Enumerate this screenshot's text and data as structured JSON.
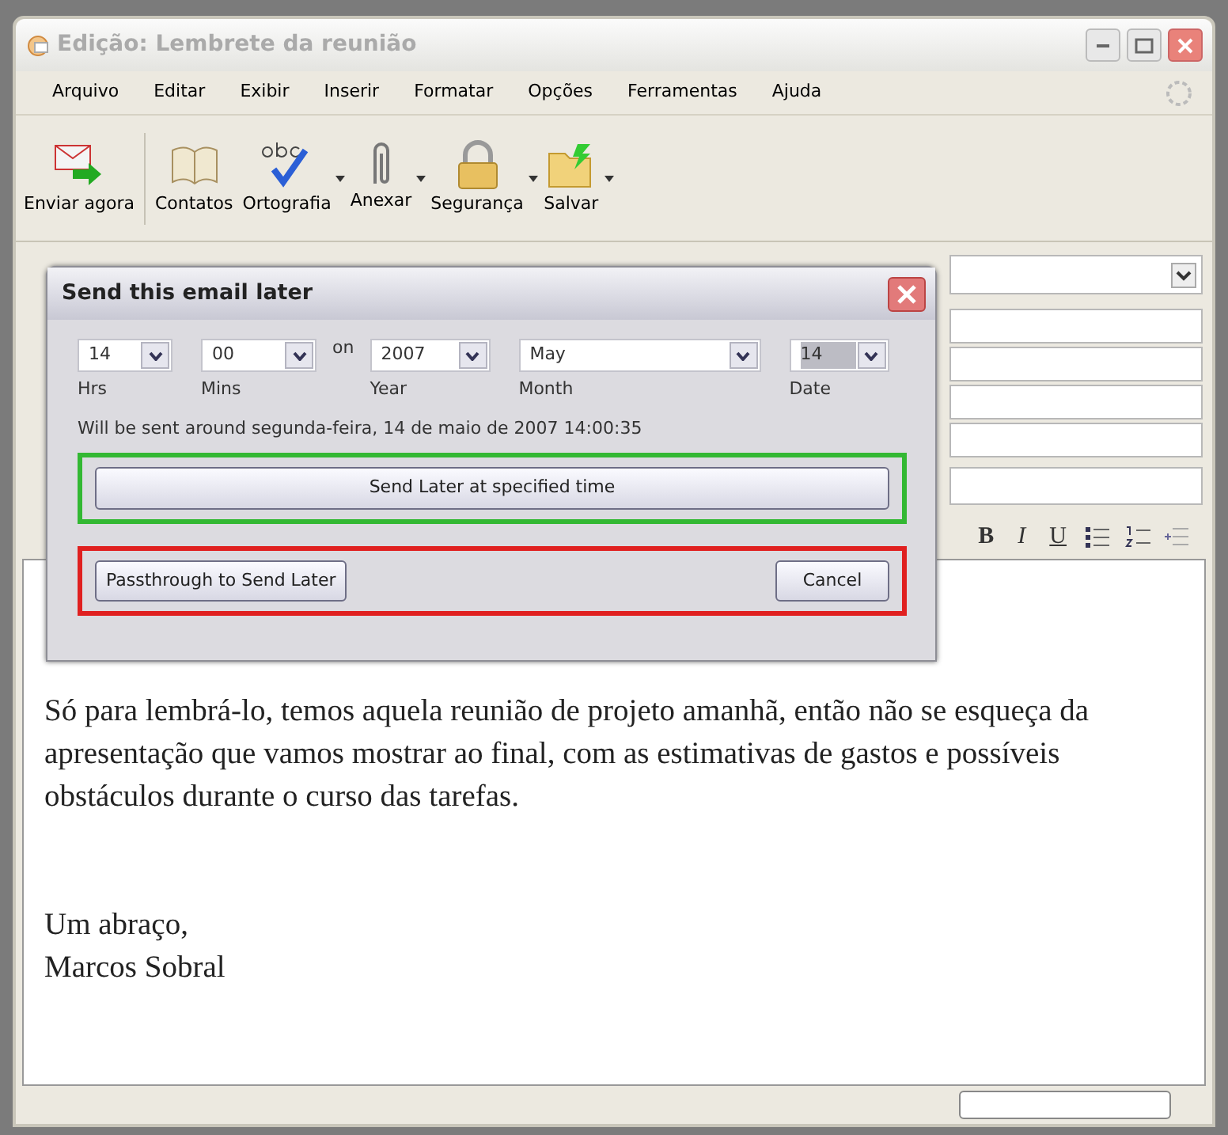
{
  "window": {
    "title": "Edição: Lembrete da reunião",
    "active": false
  },
  "menu": [
    "Arquivo",
    "Editar",
    "Exibir",
    "Inserir",
    "Formatar",
    "Opções",
    "Ferramentas",
    "Ajuda"
  ],
  "toolbar": [
    {
      "label": "Enviar agora",
      "kind": "send",
      "has_menu": false
    },
    {
      "label": "Contatos",
      "kind": "contacts",
      "has_menu": false
    },
    {
      "label": "Ortografia",
      "kind": "spelling",
      "has_menu": true
    },
    {
      "label": "Anexar",
      "kind": "attach",
      "has_menu": true
    },
    {
      "label": "Segurança",
      "kind": "security",
      "has_menu": true
    },
    {
      "label": "Salvar",
      "kind": "save",
      "has_menu": true
    }
  ],
  "format_toolbar": {
    "buttons": [
      "B",
      "I",
      "U"
    ]
  },
  "body": {
    "paragraphs": [
      "Só para lembrá-lo, temos aquela reunião de projeto amanhã, então não se esqueça da apresentação que vamos mostrar ao final, com as estimativas de gastos e possíveis obstáculos durante o curso das tarefas.",
      "Um abraço,\nMarcos Sobral"
    ]
  },
  "dialog": {
    "title": "Send this email later",
    "selects": [
      {
        "value": "14",
        "label": "Hrs",
        "focused": false
      },
      {
        "value": "00",
        "label": "Mins",
        "focused": false
      },
      {
        "value": "2007",
        "label": "Year",
        "focused": false
      },
      {
        "value": "May",
        "label": "Month",
        "focused": false
      },
      {
        "value": "14",
        "label": "Date",
        "focused": true
      }
    ],
    "on_label": "on",
    "info": "Will be sent around segunda-feira, 14 de maio de 2007 14:00:35",
    "primary_group": {
      "color": "#33b833",
      "buttons": [
        "Send Later at specified time"
      ]
    },
    "secondary_group": {
      "color": "#e02020",
      "buttons": [
        "Passthrough to Send Later",
        "Cancel"
      ]
    }
  }
}
